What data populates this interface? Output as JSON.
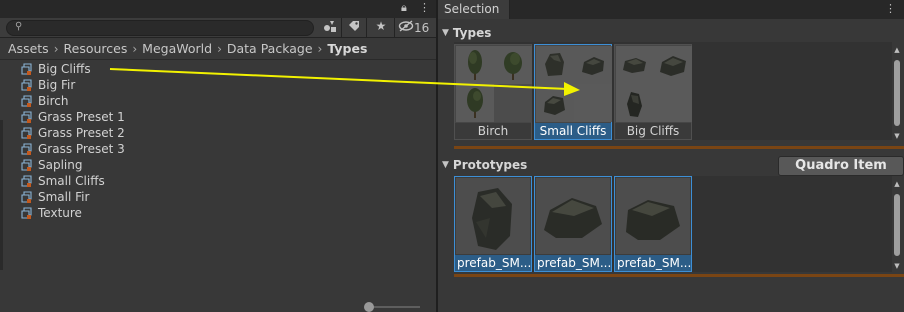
{
  "left_panel": {
    "hidden_count": "16",
    "breadcrumb": [
      "Assets",
      "Resources",
      "MegaWorld",
      "Data Package",
      "Types"
    ],
    "files": [
      "Big Cliffs",
      "Big Fir",
      "Birch",
      "Grass Preset 1",
      "Grass Preset 2",
      "Grass Preset 3",
      "Sapling",
      "Small Cliffs",
      "Small Fir",
      "Texture"
    ],
    "icons": {
      "lock": "lock-icon",
      "menu": "kebab-menu-icon",
      "search": "search-icon",
      "filter_type": "filter-by-type-icon",
      "filter_label": "filter-by-label-icon",
      "favorite": "star-icon",
      "hidden": "eye-slash-icon",
      "file": "scriptable-object-icon"
    }
  },
  "right_panel": {
    "tab_title": "Selection",
    "types_section": {
      "header": "Types",
      "cards": [
        {
          "label": "Birch",
          "selected": false
        },
        {
          "label": "Small Cliffs",
          "selected": true
        },
        {
          "label": "Big Cliffs",
          "selected": false
        }
      ]
    },
    "prototypes_section": {
      "header": "Prototypes",
      "button": "Quadro Item",
      "cards": [
        {
          "label": "prefab_SM...",
          "selected": true
        },
        {
          "label": "prefab_SM...",
          "selected": true
        },
        {
          "label": "prefab_SM...",
          "selected": true
        }
      ]
    }
  },
  "annotation": {
    "arrow_color": "#f2f200",
    "from": "Big Cliffs",
    "to": "Small Cliffs"
  },
  "colors": {
    "accent": "#3d8fd6",
    "separator": "#7a4514",
    "background": "#383838"
  }
}
